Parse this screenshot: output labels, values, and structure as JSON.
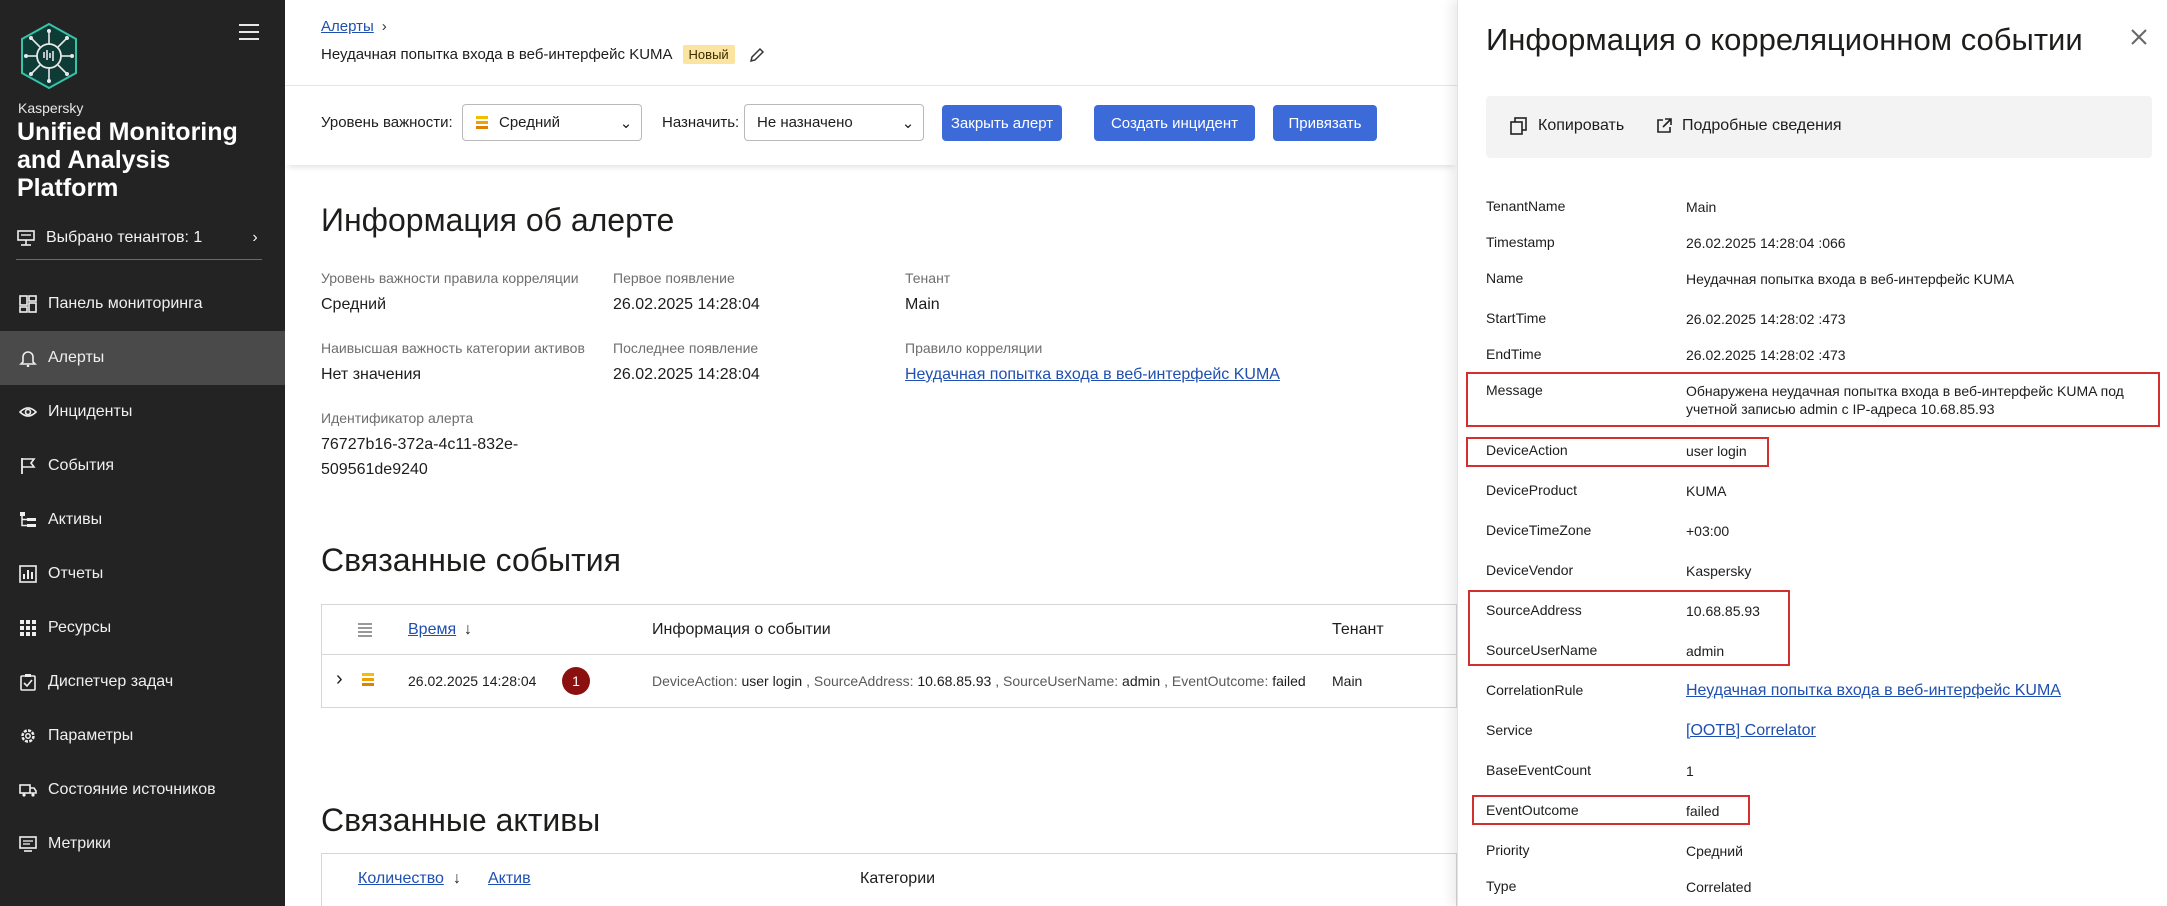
{
  "sidebar": {
    "brand_small": "Kaspersky",
    "brand_big": "Unified Monitoring and Analysis Platform",
    "tenant_label": "Выбрано тенантов: 1",
    "items": [
      {
        "label": "Панель мониторинга",
        "icon": "dashboard-icon"
      },
      {
        "label": "Алерты",
        "icon": "bell-icon"
      },
      {
        "label": "Инциденты",
        "icon": "eye-icon"
      },
      {
        "label": "События",
        "icon": "flag-icon"
      },
      {
        "label": "Активы",
        "icon": "tree-icon"
      },
      {
        "label": "Отчеты",
        "icon": "report-icon"
      },
      {
        "label": "Ресурсы",
        "icon": "grid-icon"
      },
      {
        "label": "Диспетчер задач",
        "icon": "task-icon"
      },
      {
        "label": "Параметры",
        "icon": "gear-icon"
      },
      {
        "label": "Состояние источников",
        "icon": "truck-icon"
      },
      {
        "label": "Метрики",
        "icon": "monitor-icon"
      }
    ]
  },
  "header": {
    "breadcrumb": "Алерты",
    "title": "Неудачная попытка входа в веб-интерфейс KUMA",
    "status": "Новый"
  },
  "toolbar": {
    "severity_label": "Уровень важности:",
    "severity_value": "Средний",
    "assign_label": "Назначить:",
    "assign_value": "Не назначено",
    "close_alert": "Закрыть алерт",
    "create_incident": "Создать инцидент",
    "link": "Привязать"
  },
  "alert_info": {
    "heading": "Информация об алерте",
    "rule_severity_label": "Уровень важности правила корреляции",
    "rule_severity_value": "Средний",
    "first_seen_label": "Первое появление",
    "first_seen_value": "26.02.2025 14:28:04",
    "tenant_label": "Тенант",
    "tenant_value": "Main",
    "asset_severity_label": "Наивысшая важность категории активов",
    "asset_severity_value": "Нет значения",
    "last_seen_label": "Последнее появление",
    "last_seen_value": "26.02.2025 14:28:04",
    "rule_label": "Правило корреляции",
    "rule_value": "Неудачная попытка входа в веб-интерфейс KUMA",
    "id_label": "Идентификатор алерта",
    "id_line1": "76727b16-372a-4c11-832e-",
    "id_line2": "509561de9240"
  },
  "related_events": {
    "heading": "Связанные события",
    "col_time": "Время",
    "col_info": "Информация о событии",
    "col_tenant": "Тенант",
    "row": {
      "time": "26.02.2025 14:28:04",
      "count": "1",
      "k1": "DeviceAction:",
      "v1": "user login",
      "k2": ", SourceAddress:",
      "v2": "10.68.85.93",
      "k3": ", SourceUserName:",
      "v3": "admin",
      "k4": ", EventOutcome:",
      "v4": "failed",
      "tenant": "Main"
    }
  },
  "related_assets": {
    "heading": "Связанные активы",
    "col_count": "Количество",
    "col_asset": "Актив",
    "col_categories": "Категории"
  },
  "panel": {
    "title": "Информация о корреляционном событии",
    "copy": "Копировать",
    "details": "Подробные сведения",
    "fields": [
      {
        "k": "TenantName",
        "v": "Main"
      },
      {
        "k": "Timestamp",
        "v": "26.02.2025 14:28:04 :066"
      },
      {
        "k": "Name",
        "v": "Неудачная попытка входа в веб-интерфейс KUMA"
      },
      {
        "k": "StartTime",
        "v": "26.02.2025 14:28:02 :473"
      },
      {
        "k": "EndTime",
        "v": "26.02.2025 14:28:02 :473"
      },
      {
        "k": "Message",
        "v": "Обнаружена неудачная попытка входа в веб-интерфейс KUMA под учетной записью admin с IP-адреса 10.68.85.93"
      },
      {
        "k": "DeviceAction",
        "v": "user login"
      },
      {
        "k": "DeviceProduct",
        "v": "KUMA"
      },
      {
        "k": "DeviceTimeZone",
        "v": "+03:00"
      },
      {
        "k": "DeviceVendor",
        "v": "Kaspersky"
      },
      {
        "k": "SourceAddress",
        "v": "10.68.85.93"
      },
      {
        "k": "SourceUserName",
        "v": "admin"
      },
      {
        "k": "CorrelationRule",
        "v": "Неудачная попытка входа в веб-интерфейс KUMA"
      },
      {
        "k": "Service",
        "v": "[OOTB] Correlator"
      },
      {
        "k": "BaseEventCount",
        "v": "1"
      },
      {
        "k": "EventOutcome",
        "v": "failed"
      },
      {
        "k": "Priority",
        "v": "Средний"
      },
      {
        "k": "Type",
        "v": "Correlated"
      }
    ]
  },
  "colors": {
    "accent": "#3c6ad8",
    "sidebar": "#232323",
    "highlight": "#d32f2f",
    "badge": "#8b1111"
  }
}
